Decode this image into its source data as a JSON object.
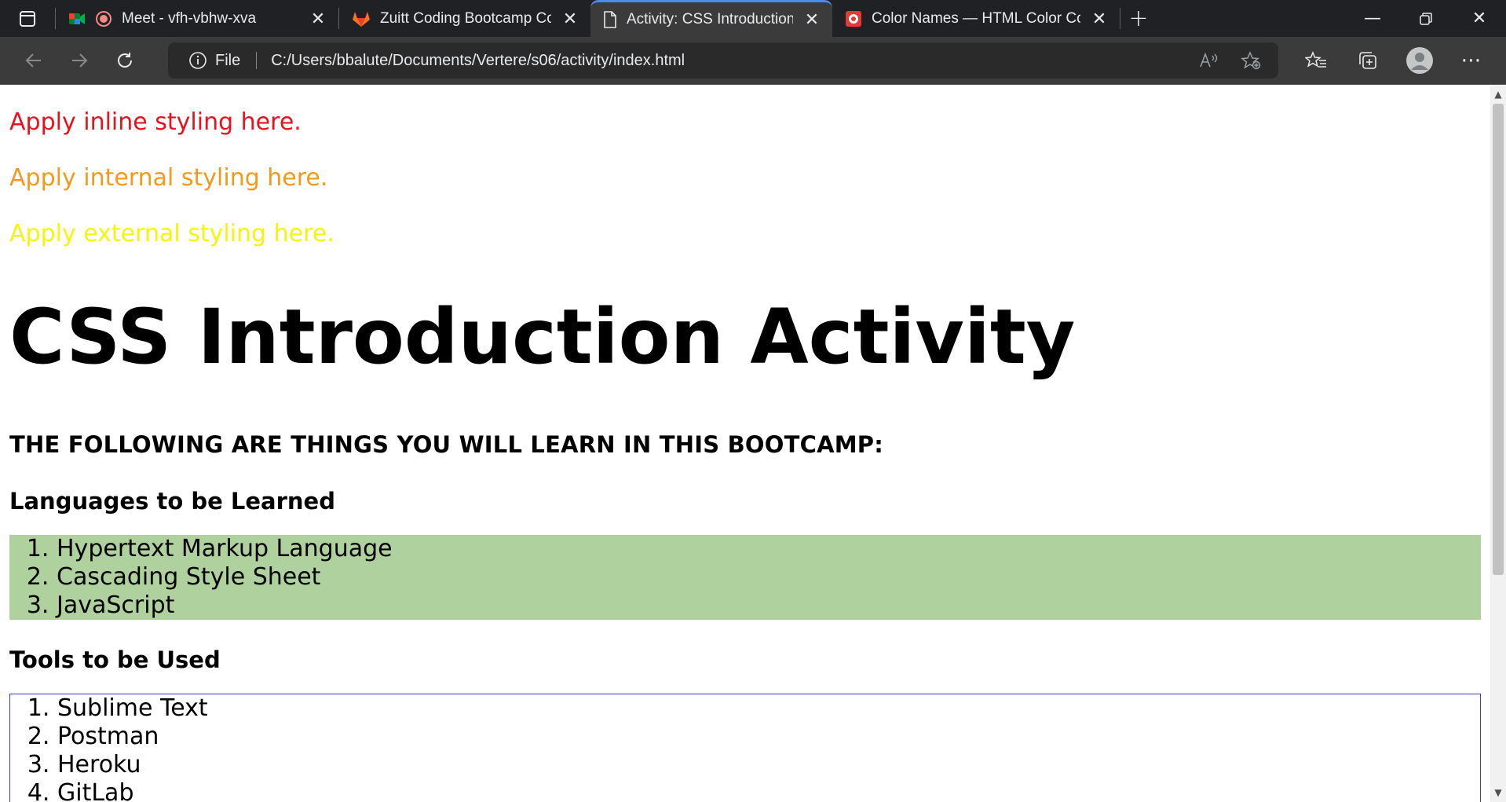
{
  "browser": {
    "tabs": [
      {
        "title": "Meet - vfh-vbhw-xva",
        "active": false
      },
      {
        "title": "Zuitt Coding Bootcamp Corporat",
        "active": false
      },
      {
        "title": "Activity: CSS Introduction",
        "active": true
      },
      {
        "title": "Color Names — HTML Color Coc",
        "active": false
      }
    ],
    "address": {
      "scheme_label": "File",
      "url": "C:/Users/bbalute/Documents/Vertere/s06/activity/index.html"
    }
  },
  "page": {
    "inline_text": "Apply inline styling here.",
    "internal_text": "Apply internal styling here.",
    "external_text": "Apply external styling here.",
    "title": "CSS Introduction Activity",
    "subtitle": "THE FOLLOWING ARE THINGS YOU WILL LEARN IN THIS BOOTCAMP:",
    "languages_heading": "Languages to be Learned",
    "languages": [
      "Hypertext Markup Language",
      "Cascading Style Sheet",
      "JavaScript"
    ],
    "tools_heading": "Tools to be Used",
    "tools": [
      "Sublime Text",
      "Postman",
      "Heroku",
      "GitLab"
    ]
  },
  "colors": {
    "inline": "#e8111c",
    "internal": "#f39a1e",
    "external": "#f5f50b",
    "languages_bg": "#aed19e",
    "tools_border": "#3b3bd8"
  }
}
